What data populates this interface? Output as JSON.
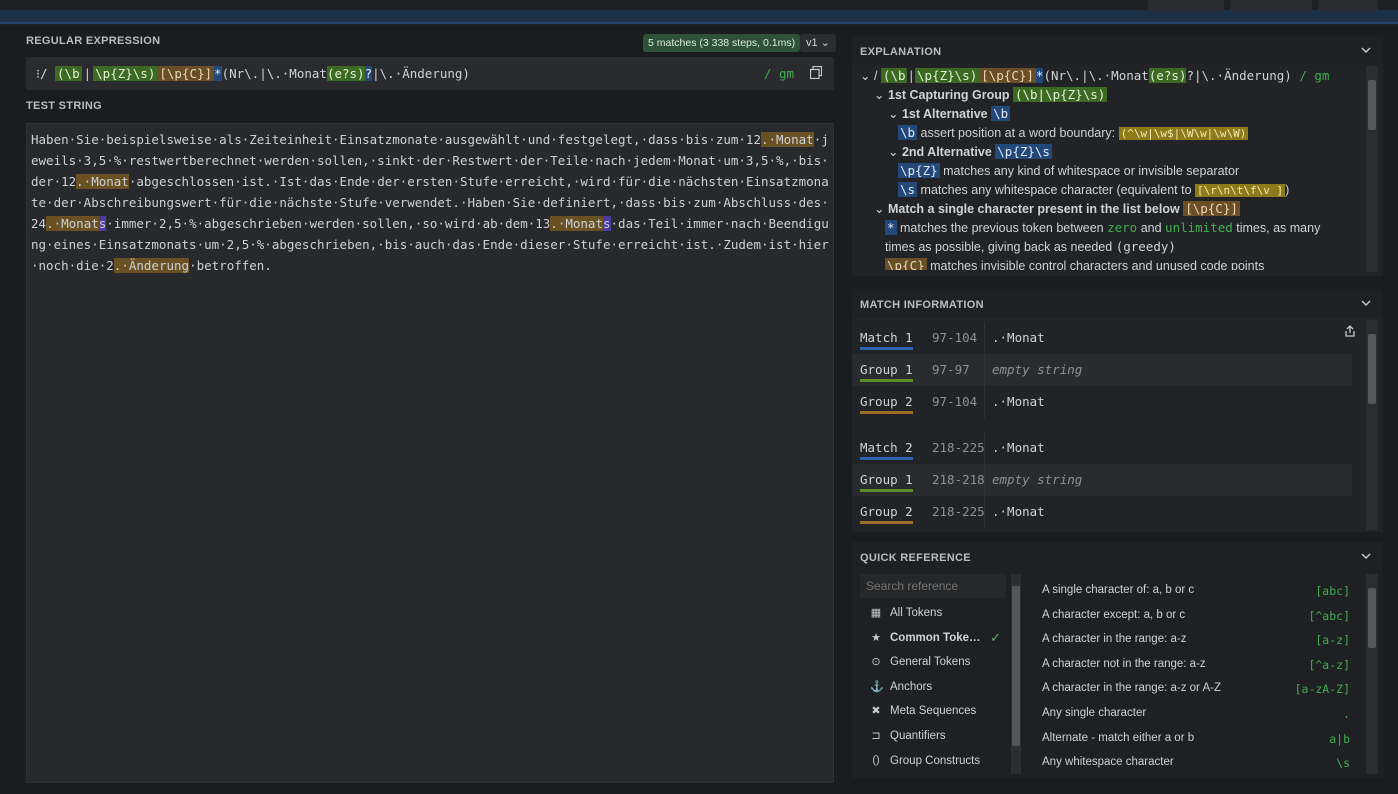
{
  "header": {
    "regex_label": "REGULAR EXPRESSION",
    "match_badge": "5 matches (3 338 steps, 0.1ms)",
    "version": "v1 ⌄",
    "regex_prefix": "⁝/",
    "regex_parts": [
      "(\\b",
      "|",
      "\\p{Z}\\s)",
      "[\\p{C}]",
      "*",
      "(Nr\\.|\\.·Monat",
      "(e?s)",
      "?",
      "|",
      "\\.·Änderung)"
    ],
    "flags": "/ gm",
    "test_label": "TEST STRING"
  },
  "test_string": {
    "segments": [
      {
        "t": "Haben·Sie·beispielsweise·als·Zeiteinheit·Einsatzmonate·ausgewählt·und·festgelegt,·dass·bis·zum·12",
        "h": ""
      },
      {
        "t": ".·Monat",
        "h": "hl1"
      },
      {
        "t": "·jeweils·3,5·%·restwertberechnet·werden·sollen,·sinkt·der·Restwert·der·Teile·nach·jedem·Monat·um·3,5·%,·bis·der·12",
        "h": ""
      },
      {
        "t": ".·Monat",
        "h": "hl1"
      },
      {
        "t": "·abgeschlossen·ist.·Ist·das·Ende·der·ersten·Stufe·erreicht,·wird·für·die·nächsten·Einsatzmonate·der·Abschreibungswert·für·die·nächste·Stufe·verwendet.·Haben·Sie·definiert,·dass·bis·zum·Abschluss·des·24",
        "h": ""
      },
      {
        "t": ".·Monat",
        "h": "hl1"
      },
      {
        "t": "s",
        "h": "hl2"
      },
      {
        "t": "·immer·2,5·%·abgeschrieben·werden·sollen,·so·wird·ab·dem·13",
        "h": ""
      },
      {
        "t": ".·Monat",
        "h": "hl1"
      },
      {
        "t": "s",
        "h": "hl2"
      },
      {
        "t": "·das·Teil·immer·nach·Beendigung·eines·Einsatzmonats·um·2,5·%·abgeschrieben,·bis·auch·das·Ende·dieser·Stufe·erreicht·ist.·Zudem·ist·hier·noch·die·2",
        "h": ""
      },
      {
        "t": ".·Änderung",
        "h": "hl1"
      },
      {
        "t": "·betroffen.",
        "h": ""
      }
    ]
  },
  "explanation": {
    "title": "EXPLANATION",
    "line1_prefix": "⌄ /",
    "line1_regex": [
      "(\\b",
      "|",
      "\\p{Z}\\s)",
      "[\\p{C}]",
      "*",
      "(Nr\\.|\\.·Monat",
      "(e?s)",
      "?|\\.·Änderung)"
    ],
    "line1_flags": "/ gm",
    "group1_label": "1st Capturing Group",
    "group1_token": "(\\b|\\p{Z}\\s)",
    "alt1_label": "1st Alternative",
    "alt1_token": "\\b",
    "b_token": "\\b",
    "b_desc": "assert position at a word boundary:",
    "b_example": "(^\\w|\\w$|\\W\\w|\\w\\W)",
    "alt2_label": "2nd Alternative",
    "alt2_token": "\\p{Z}\\s",
    "pz_token": "\\p{Z}",
    "pz_desc": "matches any kind of whitespace or invisible separator",
    "s_token": "\\s",
    "s_desc": "matches any whitespace character (equivalent to",
    "s_example": "[\\r\\n\\t\\f\\v ]",
    "s_close": ")",
    "set_label": "Match a single character present in the list below",
    "set_token": "[\\p{C}]",
    "star_token": "*",
    "star_desc1": "matches the previous token between",
    "star_zero": "zero",
    "star_and": "and",
    "star_unlimited": "unlimited",
    "star_desc2": "times, as many",
    "star_desc3": "times as possible, giving back as needed",
    "star_greedy": "(greedy)",
    "pc_token": "\\p{C}",
    "pc_desc": "matches invisible control characters and unused code points"
  },
  "match_info": {
    "title": "MATCH INFORMATION",
    "rows": [
      {
        "name": "Match 1",
        "range": "97-104",
        "value": ".·Monat",
        "kind": "match",
        "empty": false
      },
      {
        "name": "Group 1",
        "range": "97-97",
        "value": "empty string",
        "kind": "g1",
        "empty": true
      },
      {
        "name": "Group 2",
        "range": "97-104",
        "value": ".·Monat",
        "kind": "g2",
        "empty": false
      },
      {
        "name": "Match 2",
        "range": "218-225",
        "value": ".·Monat",
        "kind": "match",
        "empty": false
      },
      {
        "name": "Group 1",
        "range": "218-218",
        "value": "empty string",
        "kind": "g1",
        "empty": true
      },
      {
        "name": "Group 2",
        "range": "218-225",
        "value": ".·Monat",
        "kind": "g2",
        "empty": false
      }
    ]
  },
  "quick_ref": {
    "title": "QUICK REFERENCE",
    "search_placeholder": "Search reference",
    "categories": [
      {
        "icon": "▦",
        "label": "All Tokens"
      },
      {
        "icon": "★",
        "label": "Common Toke…",
        "active": true
      },
      {
        "icon": "⊙",
        "label": "General Tokens"
      },
      {
        "icon": "⚓",
        "label": "Anchors"
      },
      {
        "icon": "✖",
        "label": "Meta Sequences"
      },
      {
        "icon": "⊐",
        "label": "Quantifiers"
      },
      {
        "icon": "()",
        "label": "Group Constructs"
      }
    ],
    "entries": [
      {
        "desc": "A single character of: a, b or c",
        "code": "[abc]"
      },
      {
        "desc": "A character except: a, b or c",
        "code": "[^abc]"
      },
      {
        "desc": "A character in the range: a-z",
        "code": "[a-z]"
      },
      {
        "desc": "A character not in the range: a-z",
        "code": "[^a-z]"
      },
      {
        "desc": "A character in the range: a-z or A-Z",
        "code": "[a-zA-Z]"
      },
      {
        "desc": "Any single character",
        "code": "."
      },
      {
        "desc": "Alternate - match either a or b",
        "code": "a|b"
      },
      {
        "desc": "Any whitespace character",
        "code": "\\s"
      }
    ]
  },
  "colors": {
    "match": "#2d64b0",
    "group1": "#5b8e2b",
    "group2": "#9c6e2c",
    "flag": "#3fae4f"
  }
}
